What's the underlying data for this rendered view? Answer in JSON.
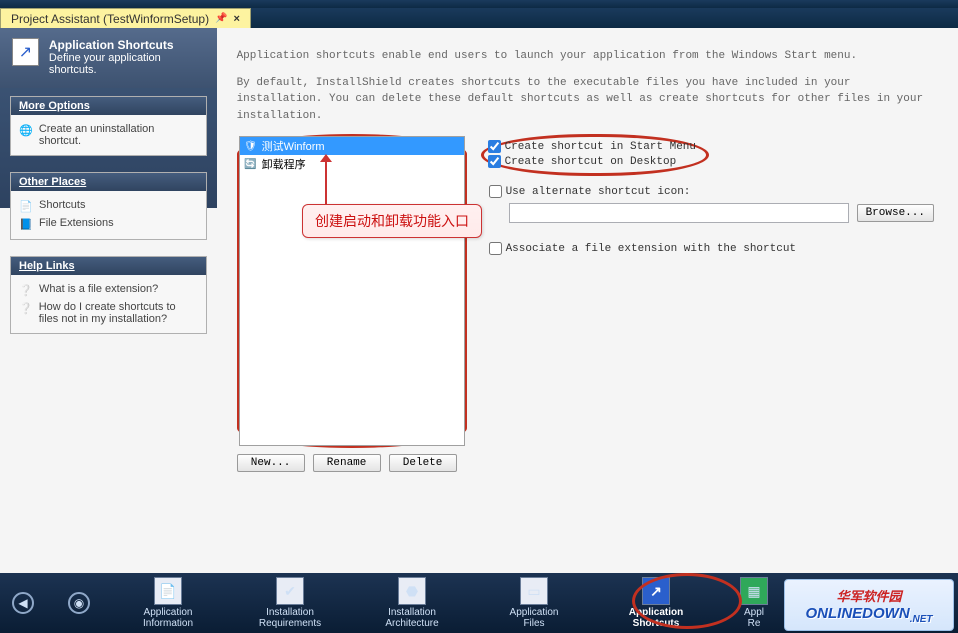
{
  "tab": {
    "title": "Project Assistant (TestWinformSetup)"
  },
  "header": {
    "title": "Application Shortcuts",
    "subtitle": "Define your application shortcuts."
  },
  "sidebar": {
    "more_options": {
      "title": "More Options",
      "items": [
        "Create an uninstallation shortcut."
      ]
    },
    "other_places": {
      "title": "Other Places",
      "items": [
        "Shortcuts",
        "File Extensions"
      ]
    },
    "help_links": {
      "title": "Help Links",
      "items": [
        "What is a file extension?",
        "How do I create shortcuts to files not in my installation?"
      ]
    }
  },
  "content": {
    "desc1": "Application shortcuts enable end users to launch your application from the Windows Start menu.",
    "desc2": "By default, InstallShield creates shortcuts to the executable files you have included in your installation. You can delete these default shortcuts as well as create shortcuts for other files in your installation.",
    "list": [
      {
        "label": "测试Winform",
        "selected": true
      },
      {
        "label": "卸载程序",
        "selected": false
      }
    ],
    "buttons": {
      "new": "New...",
      "rename": "Rename",
      "delete": "Delete"
    },
    "checks": {
      "start_menu": "Create shortcut in Start Menu",
      "desktop": "Create shortcut on Desktop",
      "alt_icon": "Use alternate shortcut icon:",
      "assoc": "Associate a file extension with the shortcut"
    },
    "browse": "Browse...",
    "annotation": "创建启动和卸载功能入口"
  },
  "nav": {
    "items": [
      {
        "label1": "Application",
        "label2": "Information"
      },
      {
        "label1": "Installation",
        "label2": "Requirements"
      },
      {
        "label1": "Installation",
        "label2": "Architecture"
      },
      {
        "label1": "Application",
        "label2": "Files"
      },
      {
        "label1": "Application",
        "label2": "Shortcuts",
        "active": true
      },
      {
        "label1": "Appl",
        "label2": "Re"
      }
    ]
  },
  "watermark": {
    "top": "华军软件园",
    "bottom": "ONLINEDOWN",
    "suffix": ".NET"
  }
}
